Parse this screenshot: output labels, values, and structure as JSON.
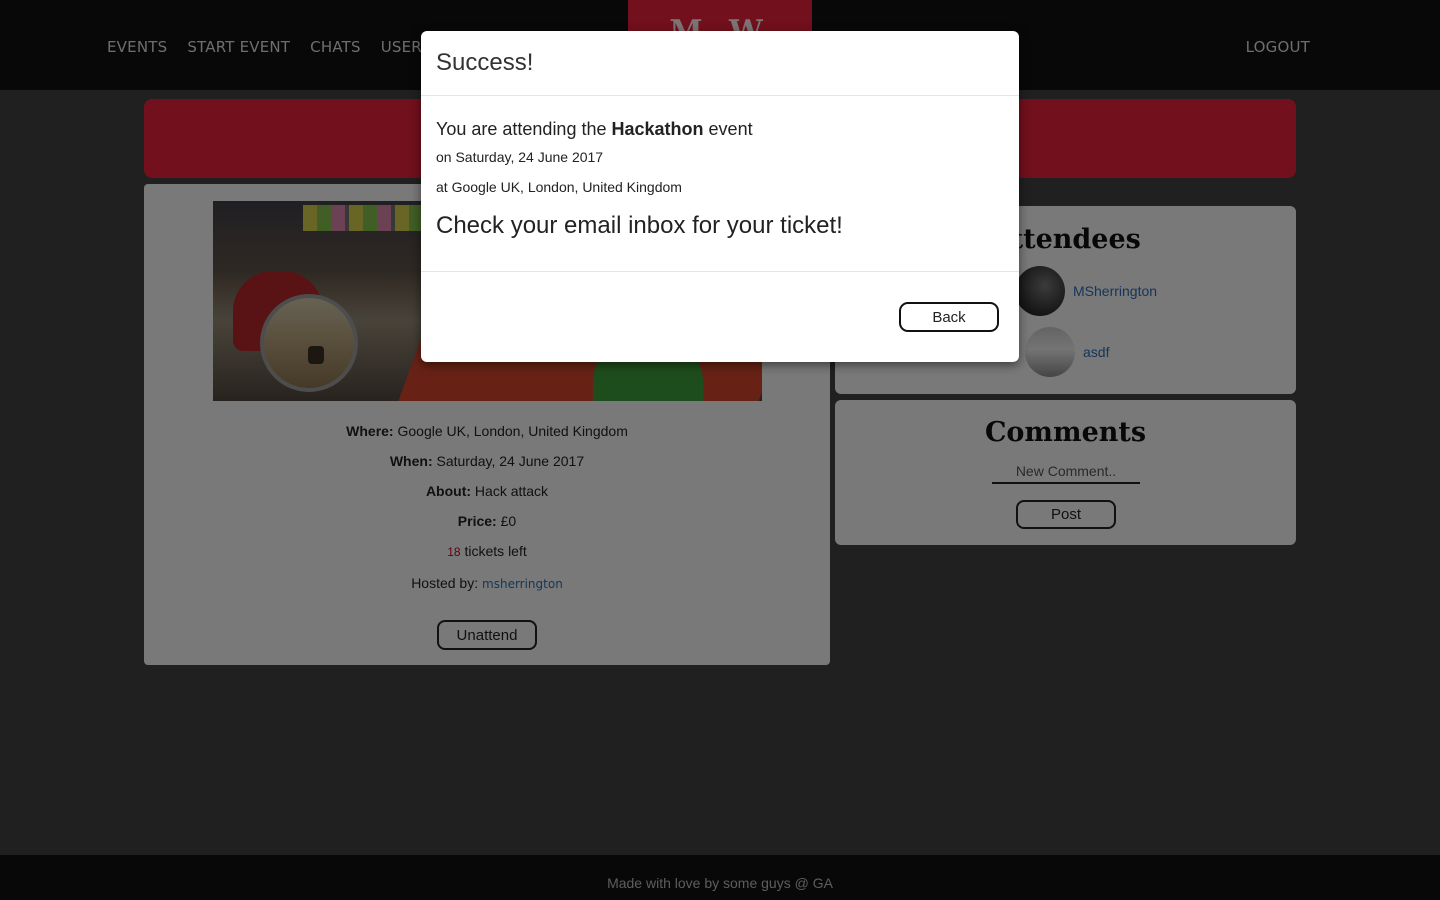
{
  "nav": {
    "items": [
      "EVENTS",
      "START EVENT",
      "CHATS",
      "USERS"
    ],
    "logout": "LOGOUT"
  },
  "event": {
    "where_label": "Where:",
    "where": "Google UK, London, United Kingdom",
    "when_label": "When:",
    "when": "Saturday, 24 June 2017",
    "about_label": "About:",
    "about": "Hack attack",
    "price_label": "Price:",
    "price": "£0",
    "tickets_count": "18",
    "tickets_suffix": "tickets left",
    "hosted_label": "Hosted by:",
    "host": "msherrington",
    "unattend_label": "Unattend"
  },
  "attendees": {
    "title": "Attendees",
    "list": [
      {
        "name": "MSherrington"
      },
      {
        "name": "asdf"
      }
    ]
  },
  "comments": {
    "title": "Comments",
    "placeholder": "New Comment..",
    "post_label": "Post"
  },
  "footer": {
    "text": "Made with love by some guys @ GA"
  },
  "modal": {
    "title": "Success!",
    "line1_prefix": "You are attending the",
    "line1_event": "Hackathon",
    "line1_suffix": "event",
    "line2": "on Saturday, 24 June 2017",
    "line3": "at Google UK, London, United Kingdom",
    "line4": "Check your email inbox for your ticket!",
    "back_label": "Back"
  },
  "colors": {
    "accent": "#e4203a",
    "navbar": "#111111",
    "link": "#2b6cb0"
  }
}
